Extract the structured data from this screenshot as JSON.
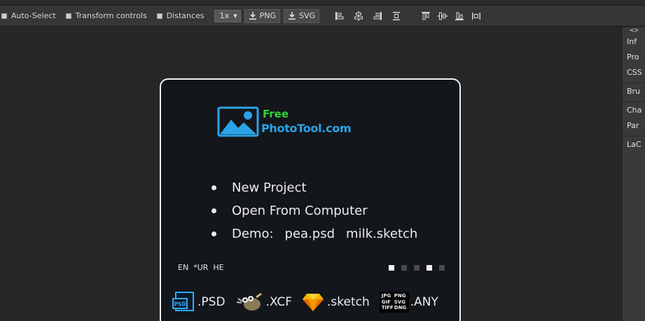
{
  "toolbar": {
    "auto_select": "Auto-Select",
    "transform_controls": "Transform controls",
    "distances": "Distances",
    "zoom": "1x",
    "png_label": "PNG",
    "svg_label": "SVG"
  },
  "right_panel": {
    "collapse": "<>",
    "tabs": [
      "Inf",
      "Pro",
      "CSS",
      "Bru",
      "Cha",
      "Par",
      "LaC"
    ]
  },
  "dialog": {
    "logo_line1": "Free",
    "logo_line2": "PhotoTool.com",
    "menu": {
      "new_project": "New Project",
      "open_from_computer": "Open From Computer",
      "demo_label": "Demo:",
      "demo_files": [
        "pea.psd",
        "milk.sketch"
      ]
    },
    "languages": [
      "EN",
      "*UR",
      "HE"
    ],
    "carousel": {
      "count": 5,
      "active_index": 3
    },
    "formats": [
      ".PSD",
      ".XCF",
      ".sketch",
      ".ANY"
    ],
    "any_grid": [
      "JPG",
      "PNG",
      "GIF",
      "SVG",
      "TIFF",
      "DNG"
    ]
  },
  "colors": {
    "logo_green": "#2fd43a",
    "logo_blue": "#2ba3e6",
    "psd_blue": "#31a8ff",
    "sketch_orange": "#f7b500",
    "dialog_bg": "#13161a"
  }
}
